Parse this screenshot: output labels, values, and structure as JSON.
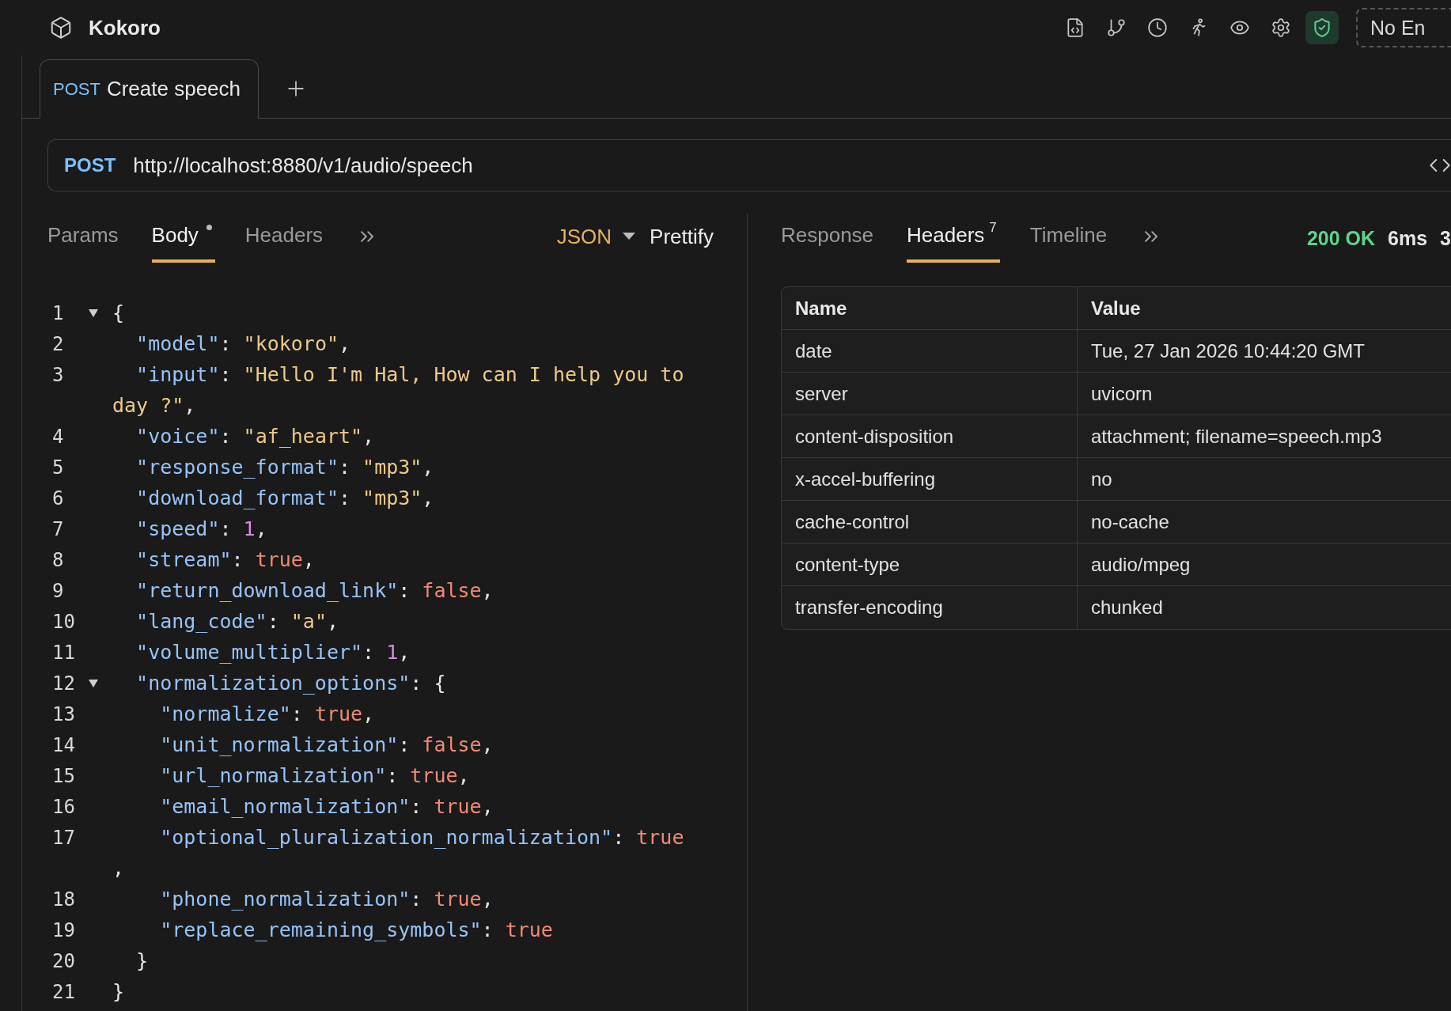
{
  "app": {
    "name": "Kokoro",
    "environment": "No En"
  },
  "tabs": [
    {
      "method": "POST",
      "label": "Create speech",
      "selected": true
    }
  ],
  "request": {
    "method": "POST",
    "url": "http://localhost:8880/v1/audio/speech"
  },
  "request_tabs": [
    {
      "label": "Params",
      "selected": false,
      "modified": false
    },
    {
      "label": "Body",
      "selected": true,
      "modified": true
    },
    {
      "label": "Headers",
      "selected": false,
      "modified": false
    }
  ],
  "body_format": "JSON",
  "prettify": "Prettify",
  "code": [
    {
      "number": "1",
      "foldable": true,
      "rows": [
        [
          {
            "kind": "punct",
            "text": "{"
          }
        ]
      ]
    },
    {
      "number": "2",
      "foldable": false,
      "rows": [
        [
          {
            "kind": "key",
            "text": "  \"model\""
          },
          {
            "kind": "punct",
            "text": ": "
          },
          {
            "kind": "string",
            "text": "\"kokoro\""
          },
          {
            "kind": "punct",
            "text": ","
          }
        ]
      ]
    },
    {
      "number": "3",
      "foldable": false,
      "rows": [
        [
          {
            "kind": "key",
            "text": "  \"input\""
          },
          {
            "kind": "punct",
            "text": ": "
          },
          {
            "kind": "string",
            "text": "\"Hello I'm Hal, How can I help you to"
          }
        ]
      ],
      "wrap": [
        {
          "kind": "string",
          "text": "day ?\""
        },
        {
          "kind": "punct",
          "text": ","
        }
      ]
    },
    {
      "number": "4",
      "foldable": false,
      "rows": [
        [
          {
            "kind": "key",
            "text": "  \"voice\""
          },
          {
            "kind": "punct",
            "text": ": "
          },
          {
            "kind": "string",
            "text": "\"af_heart\""
          },
          {
            "kind": "punct",
            "text": ","
          }
        ]
      ]
    },
    {
      "number": "5",
      "foldable": false,
      "rows": [
        [
          {
            "kind": "key",
            "text": "  \"response_format\""
          },
          {
            "kind": "punct",
            "text": ": "
          },
          {
            "kind": "string",
            "text": "\"mp3\""
          },
          {
            "kind": "punct",
            "text": ","
          }
        ]
      ]
    },
    {
      "number": "6",
      "foldable": false,
      "rows": [
        [
          {
            "kind": "key",
            "text": "  \"download_format\""
          },
          {
            "kind": "punct",
            "text": ": "
          },
          {
            "kind": "string",
            "text": "\"mp3\""
          },
          {
            "kind": "punct",
            "text": ","
          }
        ]
      ]
    },
    {
      "number": "7",
      "foldable": false,
      "rows": [
        [
          {
            "kind": "key",
            "text": "  \"speed\""
          },
          {
            "kind": "punct",
            "text": ": "
          },
          {
            "kind": "number",
            "text": "1"
          },
          {
            "kind": "punct",
            "text": ","
          }
        ]
      ]
    },
    {
      "number": "8",
      "foldable": false,
      "rows": [
        [
          {
            "kind": "key",
            "text": "  \"stream\""
          },
          {
            "kind": "punct",
            "text": ": "
          },
          {
            "kind": "bool",
            "text": "true"
          },
          {
            "kind": "punct",
            "text": ","
          }
        ]
      ]
    },
    {
      "number": "9",
      "foldable": false,
      "rows": [
        [
          {
            "kind": "key",
            "text": "  \"return_download_link\""
          },
          {
            "kind": "punct",
            "text": ": "
          },
          {
            "kind": "bool",
            "text": "false"
          },
          {
            "kind": "punct",
            "text": ","
          }
        ]
      ]
    },
    {
      "number": "10",
      "foldable": false,
      "rows": [
        [
          {
            "kind": "key",
            "text": "  \"lang_code\""
          },
          {
            "kind": "punct",
            "text": ": "
          },
          {
            "kind": "string",
            "text": "\"a\""
          },
          {
            "kind": "punct",
            "text": ","
          }
        ]
      ]
    },
    {
      "number": "11",
      "foldable": false,
      "rows": [
        [
          {
            "kind": "key",
            "text": "  \"volume_multiplier\""
          },
          {
            "kind": "punct",
            "text": ": "
          },
          {
            "kind": "number",
            "text": "1"
          },
          {
            "kind": "punct",
            "text": ","
          }
        ]
      ]
    },
    {
      "number": "12",
      "foldable": true,
      "rows": [
        [
          {
            "kind": "key",
            "text": "  \"normalization_options\""
          },
          {
            "kind": "punct",
            "text": ": {"
          }
        ]
      ]
    },
    {
      "number": "13",
      "foldable": false,
      "rows": [
        [
          {
            "kind": "key",
            "text": "    \"normalize\""
          },
          {
            "kind": "punct",
            "text": ": "
          },
          {
            "kind": "bool",
            "text": "true"
          },
          {
            "kind": "punct",
            "text": ","
          }
        ]
      ]
    },
    {
      "number": "14",
      "foldable": false,
      "rows": [
        [
          {
            "kind": "key",
            "text": "    \"unit_normalization\""
          },
          {
            "kind": "punct",
            "text": ": "
          },
          {
            "kind": "bool",
            "text": "false"
          },
          {
            "kind": "punct",
            "text": ","
          }
        ]
      ]
    },
    {
      "number": "15",
      "foldable": false,
      "rows": [
        [
          {
            "kind": "key",
            "text": "    \"url_normalization\""
          },
          {
            "kind": "punct",
            "text": ": "
          },
          {
            "kind": "bool",
            "text": "true"
          },
          {
            "kind": "punct",
            "text": ","
          }
        ]
      ]
    },
    {
      "number": "16",
      "foldable": false,
      "rows": [
        [
          {
            "kind": "key",
            "text": "    \"email_normalization\""
          },
          {
            "kind": "punct",
            "text": ": "
          },
          {
            "kind": "bool",
            "text": "true"
          },
          {
            "kind": "punct",
            "text": ","
          }
        ]
      ]
    },
    {
      "number": "17",
      "foldable": false,
      "rows": [
        [
          {
            "kind": "key",
            "text": "    \"optional_pluralization_normalization\""
          },
          {
            "kind": "punct",
            "text": ": "
          },
          {
            "kind": "bool",
            "text": "true"
          }
        ]
      ],
      "wrap": [
        {
          "kind": "punct",
          "text": ","
        }
      ]
    },
    {
      "number": "18",
      "foldable": false,
      "rows": [
        [
          {
            "kind": "key",
            "text": "    \"phone_normalization\""
          },
          {
            "kind": "punct",
            "text": ": "
          },
          {
            "kind": "bool",
            "text": "true"
          },
          {
            "kind": "punct",
            "text": ","
          }
        ]
      ]
    },
    {
      "number": "19",
      "foldable": false,
      "rows": [
        [
          {
            "kind": "key",
            "text": "    \"replace_remaining_symbols\""
          },
          {
            "kind": "punct",
            "text": ": "
          },
          {
            "kind": "bool",
            "text": "true"
          }
        ]
      ]
    },
    {
      "number": "20",
      "foldable": false,
      "rows": [
        [
          {
            "kind": "punct",
            "text": "  }"
          }
        ]
      ]
    },
    {
      "number": "21",
      "foldable": false,
      "rows": [
        [
          {
            "kind": "punct",
            "text": "}"
          }
        ]
      ]
    }
  ],
  "response_tabs": [
    {
      "label": "Response",
      "selected": false
    },
    {
      "label": "Headers",
      "selected": true,
      "badge": "7"
    },
    {
      "label": "Timeline",
      "selected": false
    }
  ],
  "status": {
    "code": "200 OK",
    "time": "6ms",
    "size": "3"
  },
  "headers_table": {
    "columns": [
      "Name",
      "Value"
    ],
    "rows": [
      [
        "date",
        "Tue, 27 Jan 2026 10:44:20 GMT"
      ],
      [
        "server",
        "uvicorn"
      ],
      [
        "content-disposition",
        "attachment; filename=speech.mp3"
      ],
      [
        "x-accel-buffering",
        "no"
      ],
      [
        "cache-control",
        "no-cache"
      ],
      [
        "content-type",
        "audio/mpeg"
      ],
      [
        "transfer-encoding",
        "chunked"
      ]
    ]
  }
}
